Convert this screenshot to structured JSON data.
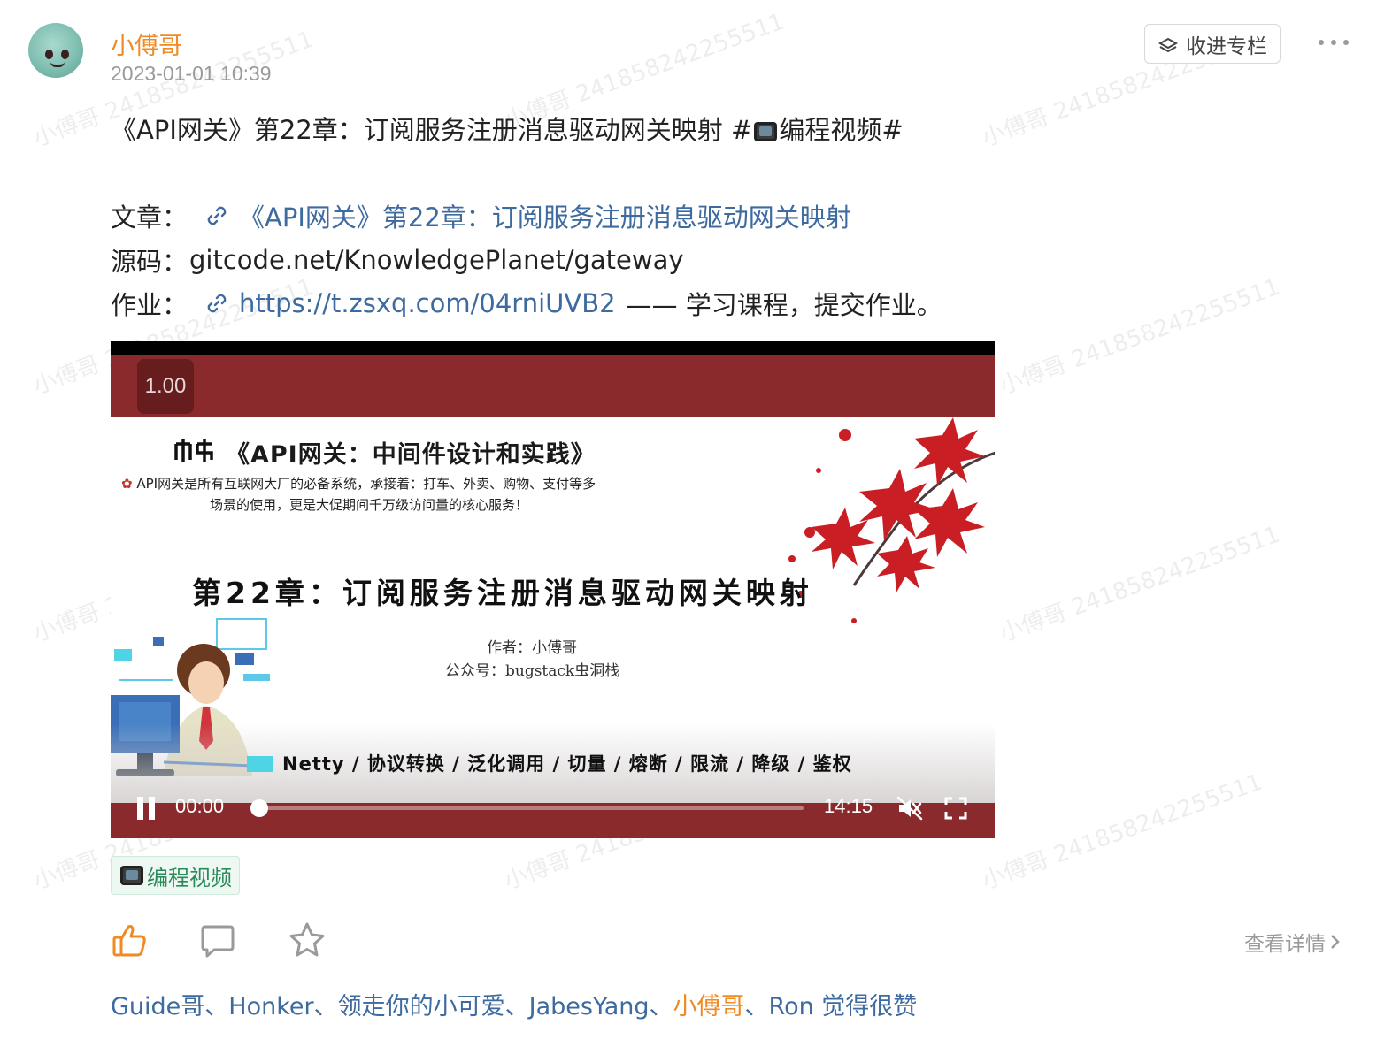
{
  "post": {
    "author": "小傅哥",
    "time": "2023-01-01 10:39",
    "collect_label": "收进专栏",
    "title_before": "《API网关》第22章：订阅服务注册消息驱动网关映射 #",
    "title_tag": "编程视频#",
    "article_label": "文章：",
    "article_link": "《API网关》第22章：订阅服务注册消息驱动网关映射",
    "source_label": "源码：",
    "source_value": "gitcode.net/KnowledgePlanet/gateway",
    "homework_label": "作业：",
    "homework_link": "https://t.zsxq.com/04rniUVB2",
    "homework_suffix": "—— 学习课程，提交作业。"
  },
  "video": {
    "speed": "1.00",
    "slide_title": "《API网关：中间件设计和实践》",
    "slide_desc_line1": "API网关是所有互联网大厂的必备系统，承接着：打车、外卖、购物、支付等多",
    "slide_desc_line2": "场景的使用，更是大促期间千万级访问量的核心服务！",
    "chapter": "第22章：订阅服务注册消息驱动网关映射",
    "author_line": "作者：小傅哥",
    "wechat_line": "公众号：bugstack虫洞栈",
    "keywords": "Netty / 协议转换 / 泛化调用 / 切量 / 熔断 / 限流 / 降级 / 鉴权",
    "current_time": "00:00",
    "duration": "14:15",
    "progress": 0
  },
  "tag": {
    "label": "编程视频"
  },
  "actions": {
    "detail_label": "查看详情"
  },
  "likers": {
    "names": [
      "Guide哥",
      "Honker",
      "领走你的小可爱",
      "JabesYang",
      "小傅哥",
      "Ron"
    ],
    "separator": "、",
    "suffix": " 觉得很赞"
  },
  "watermark": {
    "text": "小傅哥 241858242255511"
  },
  "colors": {
    "accent": "#f08a24",
    "link": "#3d6a9f",
    "video_bg": "#8b2a2c",
    "tag_text": "#2a8a59"
  },
  "icons": [
    "collect-icon",
    "more-icon",
    "link-icon",
    "tv-icon",
    "pause-icon",
    "mute-icon",
    "fullscreen-icon",
    "thumbs-up-icon",
    "comment-icon",
    "star-icon",
    "chevron-right-icon"
  ]
}
